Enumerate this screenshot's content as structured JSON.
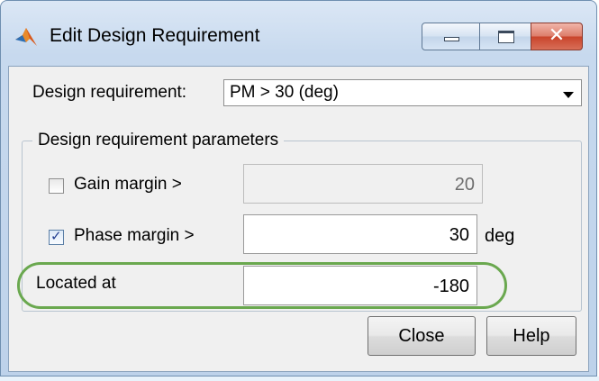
{
  "window": {
    "title": "Edit Design Requirement",
    "buttons": {
      "minimize": "minimize",
      "maximize": "maximize",
      "close": "✕"
    }
  },
  "design_requirement": {
    "label": "Design requirement:",
    "selected": "PM > 30 (deg)"
  },
  "parameters": {
    "group_title": "Design requirement parameters",
    "gain_margin": {
      "label": "Gain margin >",
      "checked": false,
      "value": "20",
      "enabled": false
    },
    "phase_margin": {
      "label": "Phase margin >",
      "checked": true,
      "value": "30",
      "unit": "deg"
    },
    "located_at": {
      "label": "Located at",
      "value": "-180"
    }
  },
  "actions": {
    "close": "Close",
    "help": "Help"
  },
  "colors": {
    "highlight": "#6aa84f",
    "close_button": "#c9452c",
    "accent": "#1f3c8f"
  }
}
